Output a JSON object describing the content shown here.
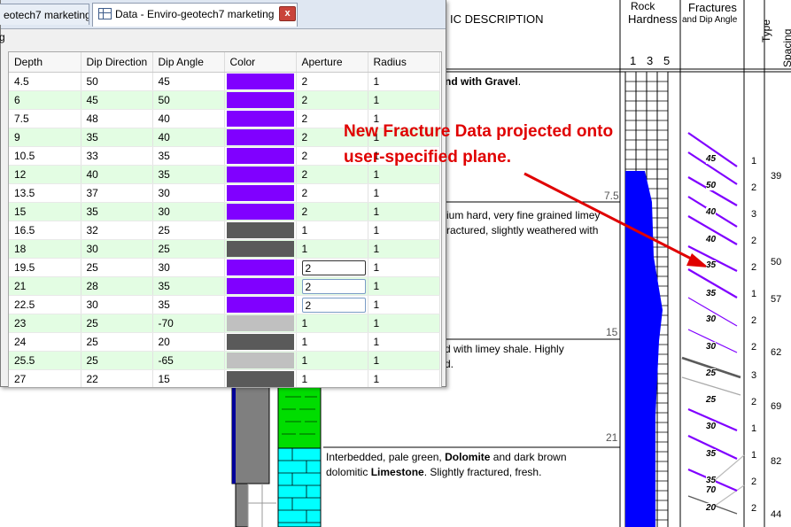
{
  "log": {
    "header_description": "IC DESCRIPTION",
    "rock_hardness_title_top": "Rock",
    "rock_hardness_title": "Hardness",
    "hardness_scale": [
      "1",
      "3",
      "5"
    ],
    "fractures_title": "Fractures",
    "fractures_subtitle": "and Dip Angle",
    "type_title": "Type",
    "spacing_title": "Spacing (cm",
    "depth_marks": [
      "7.5",
      "15",
      "21"
    ],
    "descriptions": {
      "d1_prefix": "nd with ",
      "d1_bold": "Gravel",
      "d1_suffix": ".",
      "d2_line1": "ium hard, very fine grained limey",
      "d2_line2": "ractured, slightly weathered with",
      "d3_line1": "d with limey shale. Highly",
      "d3_line2": "d.",
      "d4_prefix": "Interbedded, pale green, ",
      "d4_bold1": "Dolomite",
      "d4_mid": " and dark brown",
      "d4_line2_prefix": "dolomitic ",
      "d4_bold2": "Limestone",
      "d4_line2_suffix": ". Slightly fractured, fresh."
    },
    "fracture_labels": [
      "45",
      "50",
      "40",
      "40",
      "35",
      "35",
      "30",
      "30",
      "25",
      "25",
      "30",
      "35",
      "35",
      "70",
      "20"
    ],
    "type_values": [
      "1",
      "2",
      "3",
      "2",
      "2",
      "1",
      "2",
      "2",
      "3",
      "2",
      "1",
      "1",
      "2",
      "2"
    ],
    "spacing_values": [
      "39",
      "50",
      "57",
      "62",
      "69",
      "82",
      "44"
    ]
  },
  "window": {
    "tab_inactive": "eotech7 marketing",
    "tab_active": "Data - Enviro-geotech7 marketing",
    "close_glyph": "x",
    "toolbar_glyph": "g",
    "columns": [
      "Depth",
      "Dip Direction",
      "Dip Angle",
      "Color",
      "Aperture",
      "Radius"
    ],
    "rows": [
      {
        "depth": "4.5",
        "dipdir": "50",
        "dipangle": "45",
        "color": "#8000ff",
        "aperture": "2",
        "radius": "1",
        "bg": "#ffffff"
      },
      {
        "depth": "6",
        "dipdir": "45",
        "dipangle": "50",
        "color": "#8000ff",
        "aperture": "2",
        "radius": "1",
        "bg": "#e3fde3"
      },
      {
        "depth": "7.5",
        "dipdir": "48",
        "dipangle": "40",
        "color": "#8000ff",
        "aperture": "2",
        "radius": "1",
        "bg": "#ffffff"
      },
      {
        "depth": "9",
        "dipdir": "35",
        "dipangle": "40",
        "color": "#8000ff",
        "aperture": "2",
        "radius": "1",
        "bg": "#e3fde3"
      },
      {
        "depth": "10.5",
        "dipdir": "33",
        "dipangle": "35",
        "color": "#8000ff",
        "aperture": "2",
        "radius": "1",
        "bg": "#ffffff"
      },
      {
        "depth": "12",
        "dipdir": "40",
        "dipangle": "35",
        "color": "#8000ff",
        "aperture": "2",
        "radius": "1",
        "bg": "#e3fde3"
      },
      {
        "depth": "13.5",
        "dipdir": "37",
        "dipangle": "30",
        "color": "#8000ff",
        "aperture": "2",
        "radius": "1",
        "bg": "#ffffff"
      },
      {
        "depth": "15",
        "dipdir": "35",
        "dipangle": "30",
        "color": "#8000ff",
        "aperture": "2",
        "radius": "1",
        "bg": "#e3fde3"
      },
      {
        "depth": "16.5",
        "dipdir": "32",
        "dipangle": "25",
        "color": "#5a5a5a",
        "aperture": "1",
        "radius": "1",
        "bg": "#ffffff"
      },
      {
        "depth": "18",
        "dipdir": "30",
        "dipangle": "25",
        "color": "#5a5a5a",
        "aperture": "1",
        "radius": "1",
        "bg": "#e3fde3"
      },
      {
        "depth": "19.5",
        "dipdir": "25",
        "dipangle": "30",
        "color": "#8000ff",
        "aperture": "2",
        "radius": "1",
        "bg": "#ffffff"
      },
      {
        "depth": "21",
        "dipdir": "28",
        "dipangle": "35",
        "color": "#8000ff",
        "aperture": "2",
        "radius": "1",
        "bg": "#e3fde3"
      },
      {
        "depth": "22.5",
        "dipdir": "30",
        "dipangle": "35",
        "color": "#8000ff",
        "aperture": "2",
        "radius": "1",
        "bg": "#ffffff"
      },
      {
        "depth": "23",
        "dipdir": "25",
        "dipangle": "-70",
        "color": "#c0c0c0",
        "aperture": "1",
        "radius": "1",
        "bg": "#e3fde3"
      },
      {
        "depth": "24",
        "dipdir": "25",
        "dipangle": "20",
        "color": "#5a5a5a",
        "aperture": "1",
        "radius": "1",
        "bg": "#ffffff"
      },
      {
        "depth": "25.5",
        "dipdir": "25",
        "dipangle": "-65",
        "color": "#c0c0c0",
        "aperture": "1",
        "radius": "1",
        "bg": "#e3fde3"
      },
      {
        "depth": "27",
        "dipdir": "22",
        "dipangle": "15",
        "color": "#5a5a5a",
        "aperture": "1",
        "radius": "1",
        "bg": "#ffffff"
      }
    ]
  },
  "callout": {
    "line1": "New Fracture Data projected onto",
    "line2": "user-specified plane.",
    "color": "#e00000"
  }
}
